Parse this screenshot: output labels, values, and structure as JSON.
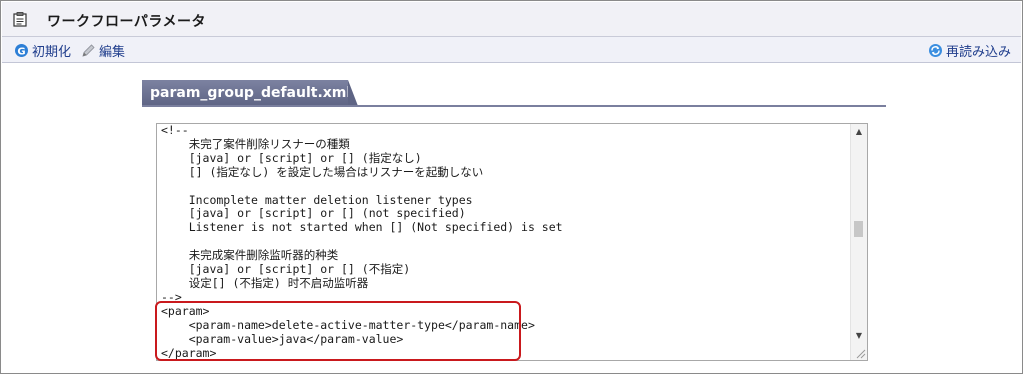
{
  "header": {
    "title": "ワークフローパラメータ",
    "icon": "clipboard-icon"
  },
  "toolbar": {
    "init_label": "初期化",
    "edit_label": "編集",
    "reload_label": "再読み込み"
  },
  "tab": {
    "label": "param_group_default.xml"
  },
  "editor": {
    "lines": [
      "<!--",
      "    未完了案件削除リスナーの種類",
      "    [java] or [script] or [] (指定なし)",
      "    [] (指定なし) を設定した場合はリスナーを起動しない",
      "",
      "    Incomplete matter deletion listener types",
      "    [java] or [script] or [] (not specified)",
      "    Listener is not started when [] (Not specified) is set",
      "",
      "    未完成案件删除监听器的种类",
      "    [java] or [script] or [] (不指定)",
      "    设定[] (不指定) 时不启动监听器",
      "-->",
      "<param>",
      "    <param-name>delete-active-matter-type</param-name>",
      "    <param-value>java</param-value>",
      "</param>"
    ]
  },
  "colors": {
    "highlight": "#c9191d",
    "tab": "#5e6484",
    "link": "#1f3d8c"
  }
}
